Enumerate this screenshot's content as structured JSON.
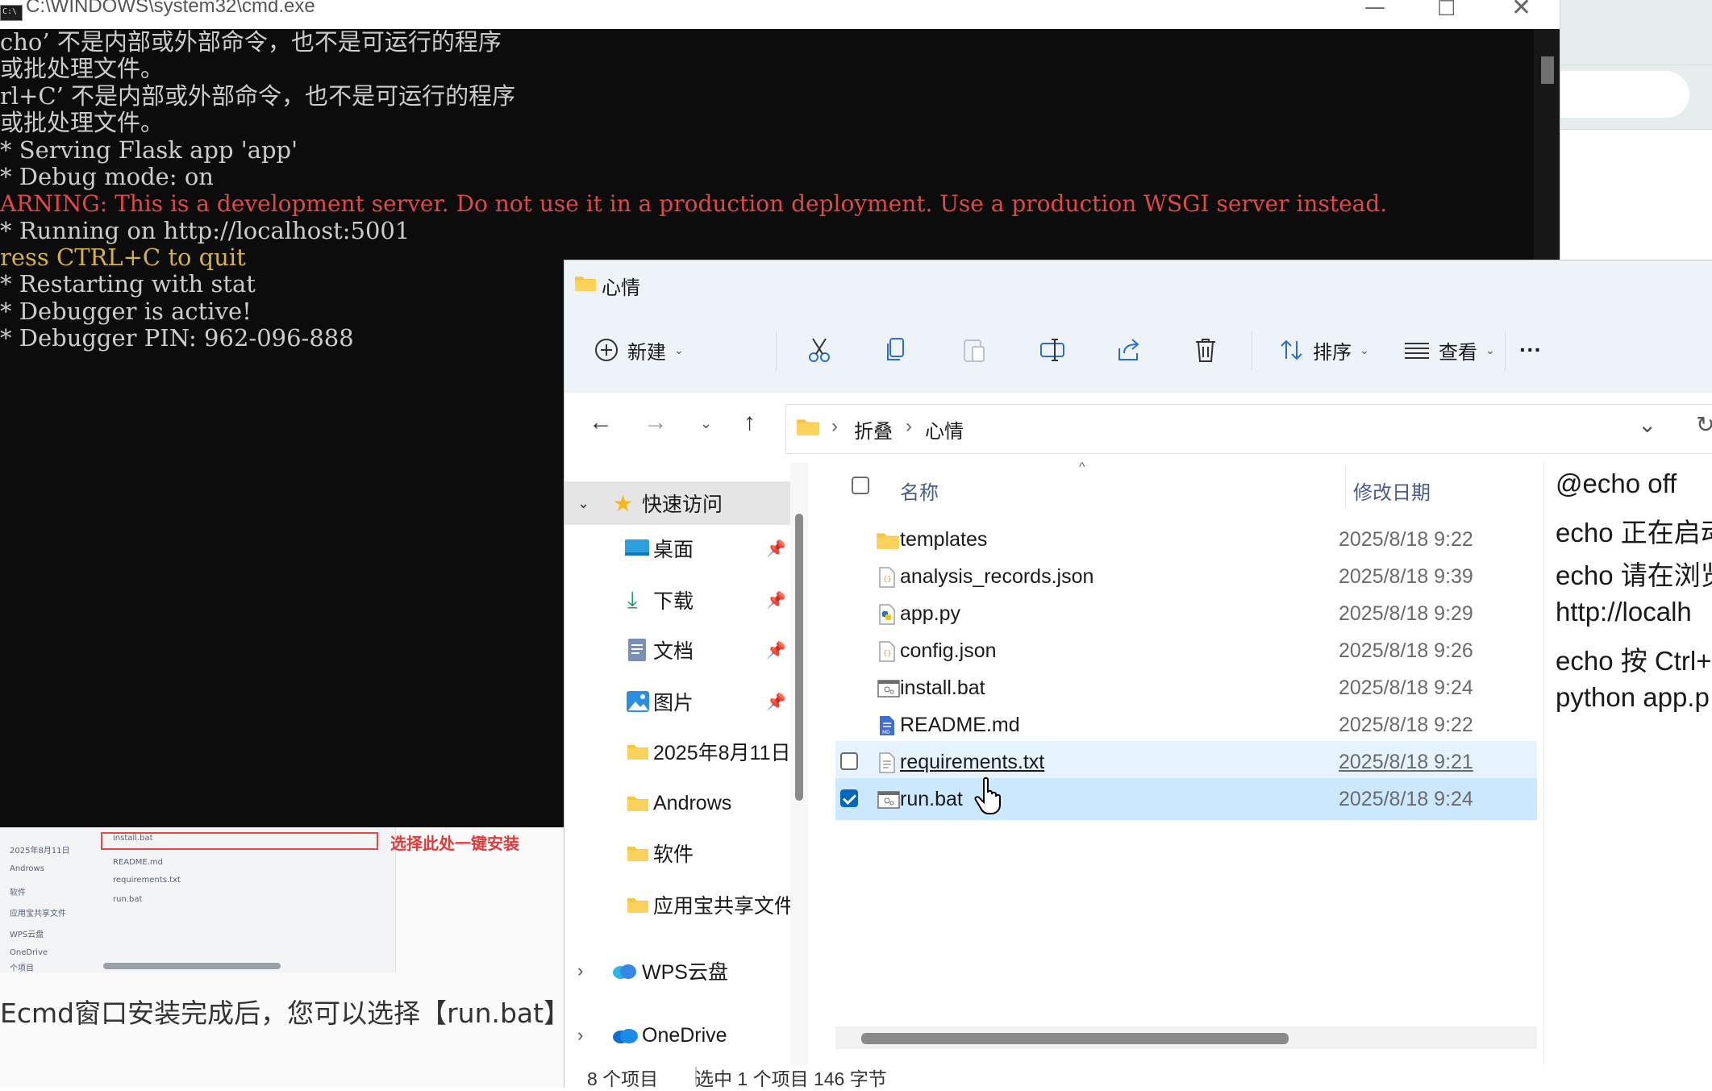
{
  "cmd": {
    "title": "C:\\WINDOWS\\system32\\cmd.exe",
    "icon": "cmd-icon",
    "lines": [
      {
        "text": "cho’ 不是内部或外部命令，也不是可运行的程序",
        "color": "white"
      },
      {
        "text": "或批处理文件。",
        "color": "white"
      },
      {
        "text": "rl+C’ 不是内部或外部命令，也不是可运行的程序",
        "color": "white"
      },
      {
        "text": "或批处理文件。",
        "color": "white"
      },
      {
        "text": "* Serving Flask app 'app'",
        "color": "white"
      },
      {
        "text": "* Debug mode: on",
        "color": "white"
      },
      {
        "text": "ARNING: This is a development server. Do not use it in a production deployment. Use a production WSGI server instead.",
        "color": "red"
      },
      {
        "text": "* Running on http://localhost:5001",
        "color": "white"
      },
      {
        "text": "ress CTRL+C to quit",
        "color": "yellow"
      },
      {
        "text": "* Restarting with stat",
        "color": "white"
      },
      {
        "text": "* Debugger is active!",
        "color": "white"
      },
      {
        "text": "* Debugger PIN: 962-096-888",
        "color": "white"
      }
    ]
  },
  "background": {
    "annotation": "选择此处一键安装",
    "caption": "Ecmd窗口安装完成后，您可以选择【run.bat】",
    "thumb_rows": [
      "2025年8月11日",
      "Androws",
      "软件",
      "应用宝共享文件",
      "WPS云盘",
      "OneDrive",
      "个项目"
    ],
    "thumb_files": [
      "install.bat",
      "README.md",
      "requirements.txt",
      "run.bat"
    ]
  },
  "explorer": {
    "title": "心情",
    "toolbar": {
      "new_label": "新建",
      "sort_label": "排序",
      "view_label": "查看",
      "more_label": "···"
    },
    "breadcrumb": [
      "折叠",
      "心情"
    ],
    "sidebar": {
      "quick_access": "快速访问",
      "items": [
        {
          "label": "桌面",
          "icon": "desktop-icon",
          "pinned": true
        },
        {
          "label": "下载",
          "icon": "download-icon",
          "pinned": true
        },
        {
          "label": "文档",
          "icon": "document-icon",
          "pinned": true
        },
        {
          "label": "图片",
          "icon": "picture-icon",
          "pinned": true
        },
        {
          "label": "2025年8月11日",
          "icon": "folder-icon",
          "pinned": false
        },
        {
          "label": "Androws",
          "icon": "folder-icon",
          "pinned": false
        },
        {
          "label": "软件",
          "icon": "folder-icon",
          "pinned": false
        },
        {
          "label": "应用宝共享文件",
          "icon": "folder-icon",
          "pinned": false
        }
      ],
      "wps": "WPS云盘",
      "onedrive": "OneDrive"
    },
    "columns": {
      "name": "名称",
      "date": "修改日期"
    },
    "files": [
      {
        "name": "templates",
        "date": "2025/8/18 9:22",
        "icon": "folder-icon",
        "state": ""
      },
      {
        "name": "analysis_records.json",
        "date": "2025/8/18 9:39",
        "icon": "json-file-icon",
        "state": ""
      },
      {
        "name": "app.py",
        "date": "2025/8/18 9:29",
        "icon": "python-file-icon",
        "state": ""
      },
      {
        "name": "config.json",
        "date": "2025/8/18 9:26",
        "icon": "json-file-icon",
        "state": ""
      },
      {
        "name": "install.bat",
        "date": "2025/8/18 9:24",
        "icon": "bat-file-icon",
        "state": ""
      },
      {
        "name": "README.md",
        "date": "2025/8/18 9:22",
        "icon": "markdown-file-icon",
        "state": ""
      },
      {
        "name": "requirements.txt",
        "date": "2025/8/18 9:21",
        "icon": "text-file-icon",
        "state": "hover"
      },
      {
        "name": "run.bat",
        "date": "2025/8/18 9:24",
        "icon": "bat-file-icon",
        "state": "selected"
      }
    ],
    "preview_lines": [
      "@echo off",
      "echo 正在启动",
      "echo 请在浏览",
      "http://localh",
      "echo 按 Ctrl+",
      "python app.p"
    ],
    "status": {
      "count": "8 个项目",
      "selected": "选中 1 个项目 146 字节"
    }
  }
}
